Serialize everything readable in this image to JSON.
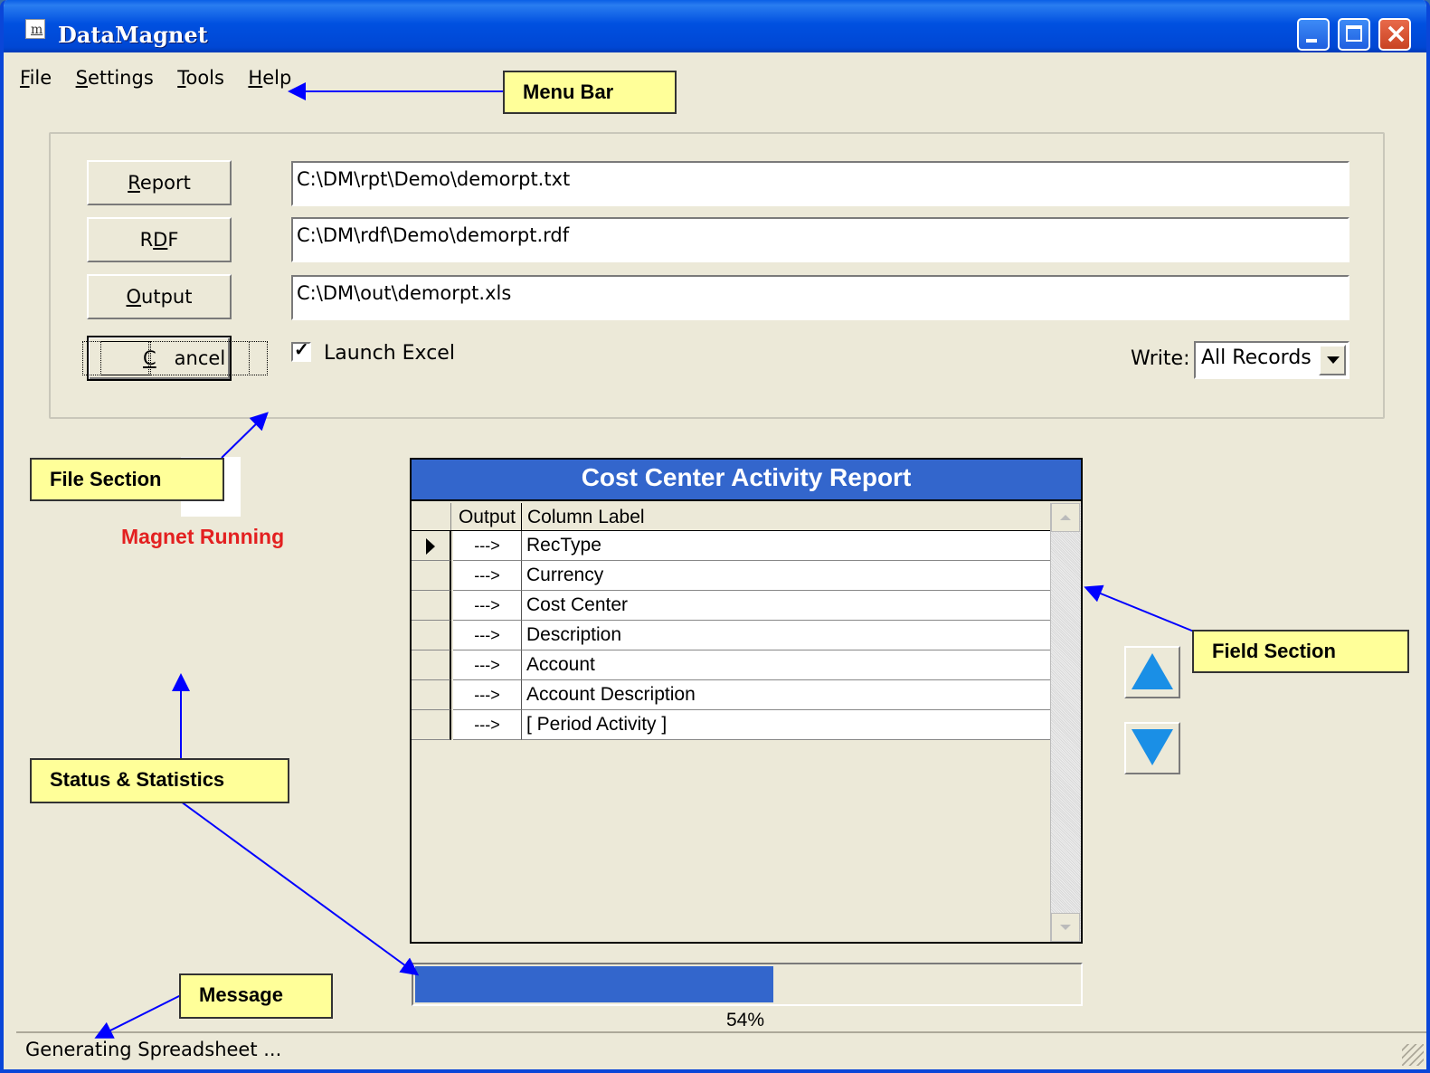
{
  "window": {
    "title": "DataMagnet"
  },
  "menu": {
    "items": [
      {
        "key": "F",
        "rest": "ile"
      },
      {
        "key": "S",
        "rest": "ettings"
      },
      {
        "key": "T",
        "rest": "ools"
      },
      {
        "key": "H",
        "rest": "elp"
      }
    ]
  },
  "file_section": {
    "report_button": {
      "pre": "",
      "key": "R",
      "post": "eport"
    },
    "rdf_button": {
      "pre": "R",
      "key": "D",
      "post": "F"
    },
    "output_button": {
      "pre": "",
      "key": "O",
      "post": "utput"
    },
    "cancel_button": {
      "pre": "",
      "key": "C",
      "post": "ancel"
    },
    "report_path": "C:\\DM\\rpt\\Demo\\demorpt.txt",
    "rdf_path": "C:\\DM\\rdf\\Demo\\demorpt.rdf",
    "output_path": "C:\\DM\\out\\demorpt.xls",
    "launch_excel_label": "Launch Excel",
    "launch_excel_checked": true,
    "write_label": "Write:",
    "write_value": "All Records"
  },
  "status": {
    "text": "Magnet Running",
    "color": "#e32020"
  },
  "field_grid": {
    "title": "Cost Center Activity Report",
    "columns": [
      "Output",
      "Column Label"
    ],
    "rows": [
      {
        "output": "--->",
        "label": "RecType",
        "current": true
      },
      {
        "output": "--->",
        "label": "Currency",
        "current": false
      },
      {
        "output": "--->",
        "label": "Cost Center",
        "current": false
      },
      {
        "output": "--->",
        "label": "Description",
        "current": false
      },
      {
        "output": "--->",
        "label": "Account",
        "current": false
      },
      {
        "output": "--->",
        "label": "Account Description",
        "current": false
      },
      {
        "output": "--->",
        "label": "[ Period Activity ]",
        "current": false
      }
    ]
  },
  "progress": {
    "fraction": 0.54,
    "label": "54%"
  },
  "statusbar": {
    "text": "Generating Spreadsheet ..."
  },
  "callouts": {
    "menu_bar": "Menu Bar",
    "file_section": "File Section",
    "field_section": "Field Section",
    "status_stats": "Status & Statistics",
    "message": "Message"
  },
  "colors": {
    "titlebar": "#0050e0",
    "grid_header": "#3366cc",
    "callout": "#ffff99",
    "arrow": "#0000ff",
    "move_buttons": "#1a8fe6"
  }
}
